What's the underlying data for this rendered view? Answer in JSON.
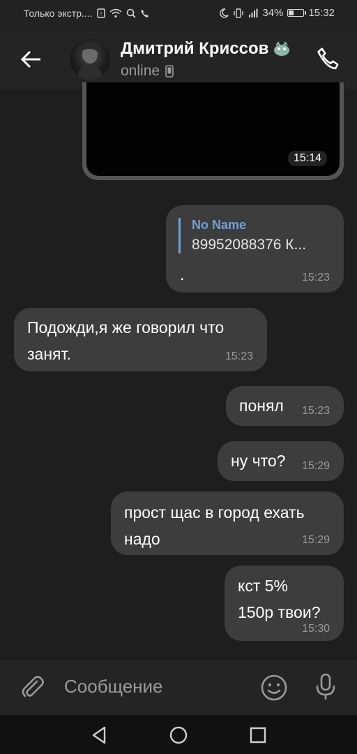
{
  "status_bar": {
    "carrier": "Только экстр....",
    "battery_percent": "34%",
    "battery_level": 0.34,
    "time": "15:32"
  },
  "header": {
    "contact_name": "Дмитрий Криссов",
    "status": "online",
    "icons": {
      "back": "arrow-left-icon",
      "call": "phone-icon",
      "device": "mobile-device-icon",
      "badge": "emoji-badge-icon"
    }
  },
  "messages": [
    {
      "type": "media",
      "time": "15:14"
    },
    {
      "type": "outgoing",
      "quote_name": "No Name",
      "quote_text": "89952088376 К...",
      "text": ".",
      "time": "15:23"
    },
    {
      "type": "incoming",
      "lines": [
        "Подожди,я же говорил что",
        "занят."
      ],
      "time": "15:23"
    },
    {
      "type": "outgoing",
      "text": "понял",
      "time": "15:23"
    },
    {
      "type": "outgoing",
      "text": "ну что?",
      "time": "15:29"
    },
    {
      "type": "outgoing",
      "lines": [
        "прост щас в город ехать",
        "надо"
      ],
      "time": "15:29"
    },
    {
      "type": "outgoing",
      "lines": [
        "кст 5%",
        "150р твои?"
      ],
      "time": "15:30"
    }
  ],
  "input": {
    "placeholder": "Сообщение",
    "icons": {
      "attach": "paperclip-icon",
      "emoji": "emoji-icon",
      "mic": "microphone-icon"
    }
  },
  "nav": {
    "icons": [
      "nav-back-icon",
      "nav-home-icon",
      "nav-recents-icon"
    ]
  },
  "colors": {
    "background": "#1e1e1e",
    "bubble": "#3d3d3d",
    "accent": "#6ea2d8"
  }
}
